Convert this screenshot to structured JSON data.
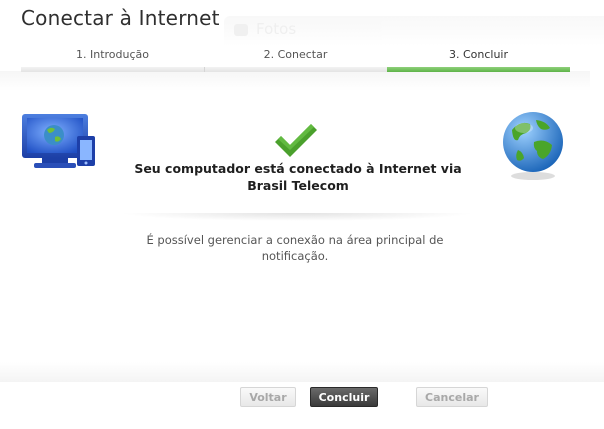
{
  "window": {
    "title": "Conectar à Internet",
    "background_app_label": "Fotos"
  },
  "steps": [
    {
      "label": "1. Introdução",
      "active": false
    },
    {
      "label": "2. Conectar",
      "active": false
    },
    {
      "label": "3. Concluir",
      "active": true
    }
  ],
  "main": {
    "status_message": "Seu computador está conectado à Internet via Brasil Telecom",
    "info_message": "É possível gerenciar a conexão na área principal de notificação."
  },
  "footer": {
    "back_label": "Voltar",
    "finish_label": "Concluir",
    "cancel_label": "Cancelar"
  },
  "colors": {
    "accent_green": "#5db348",
    "check_green": "#4aa02c",
    "primary_button": "#3a3a3a"
  },
  "icons": [
    "computer-devices-icon",
    "checkmark-icon",
    "globe-icon"
  ]
}
